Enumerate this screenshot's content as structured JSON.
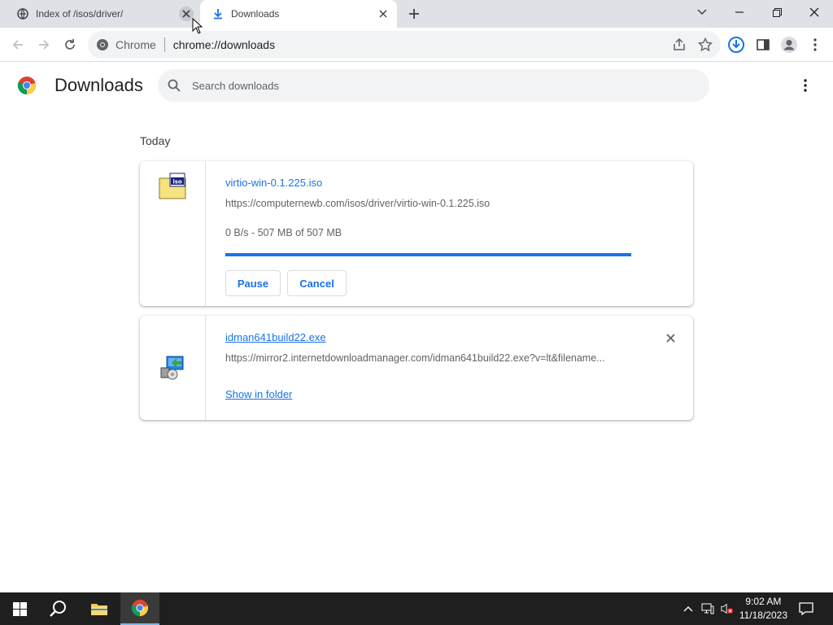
{
  "tabs": [
    {
      "title": "Index of /isos/driver/",
      "active": false
    },
    {
      "title": "Downloads",
      "active": true
    }
  ],
  "omnibox": {
    "site_chip": "Chrome",
    "url": "chrome://downloads"
  },
  "page": {
    "title": "Downloads",
    "search_placeholder": "Search downloads",
    "section_label": "Today"
  },
  "downloads": [
    {
      "file_name": "virtio-win-0.1.225.iso",
      "url": "https://computernewb.com/isos/driver/virtio-win-0.1.225.iso",
      "status": "0 B/s - 507 MB of 507 MB",
      "progress_fraction": 1.0,
      "pause_label": "Pause",
      "cancel_label": "Cancel",
      "icon": "iso-file-icon"
    },
    {
      "file_name": "idman641build22.exe",
      "url": "https://mirror2.internetdownloadmanager.com/idman641build22.exe?v=lt&filename...",
      "action_label": "Show in folder",
      "icon": "installer-file-icon"
    }
  ],
  "taskbar": {
    "time": "9:02 AM",
    "date": "11/18/2023"
  },
  "colors": {
    "accent": "#1a73e8",
    "tabstrip": "#dee1e6",
    "taskbar": "#1f1f1f"
  }
}
